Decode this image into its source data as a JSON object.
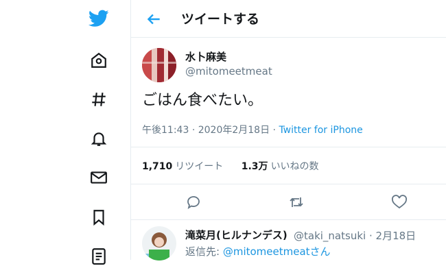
{
  "nav": {
    "icons": [
      "twitter-logo",
      "home-icon",
      "hashtag-icon",
      "bell-icon",
      "mail-icon",
      "bookmark-icon",
      "list-icon"
    ]
  },
  "header": {
    "title": "ツイートする"
  },
  "tweet": {
    "author_name": "水卜麻美",
    "author_handle": "@mitomeetmeat",
    "text": "ごはん食べたい。",
    "time": "午後11:43",
    "sep": "·",
    "date": "2020年2月18日",
    "source": "Twitter for iPhone",
    "retweets_count": "1,710",
    "retweets_label": "リツイート",
    "likes_count": "1.3万",
    "likes_label": "いいねの数"
  },
  "reply": {
    "author_name": "滝菜月(ヒルナンデス)",
    "author_handle": "@taki_natsuki",
    "sep": "·",
    "date": "2月18日",
    "replying_prefix": "返信先:",
    "replying_to": "@mitomeetmeat",
    "replying_suffix": "さん"
  },
  "colors": {
    "accent": "#1da1f2",
    "link": "#1b95e0",
    "muted": "#657786",
    "border": "#e6ecf0"
  }
}
